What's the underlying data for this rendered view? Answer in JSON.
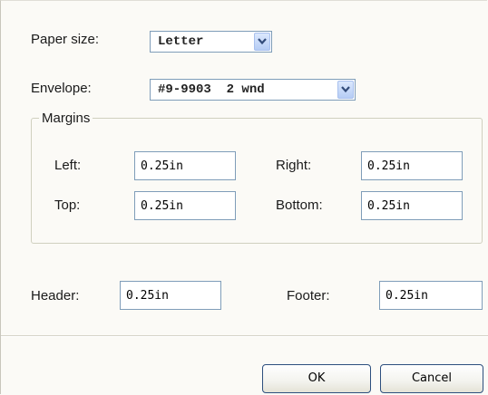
{
  "paper_size": {
    "label": "Paper size:",
    "value": "Letter"
  },
  "envelope": {
    "label": "Envelope:",
    "value": "#9-9903  2 wnd"
  },
  "margins": {
    "legend": "Margins",
    "left": {
      "label": "Left:",
      "value": "0.25in"
    },
    "right": {
      "label": "Right:",
      "value": "0.25in"
    },
    "top": {
      "label": "Top:",
      "value": "0.25in"
    },
    "bottom": {
      "label": "Bottom:",
      "value": "0.25in"
    }
  },
  "header": {
    "label": "Header:",
    "value": "0.25in"
  },
  "footer": {
    "label": "Footer:",
    "value": "0.25in"
  },
  "buttons": {
    "ok": "OK",
    "cancel": "Cancel"
  }
}
